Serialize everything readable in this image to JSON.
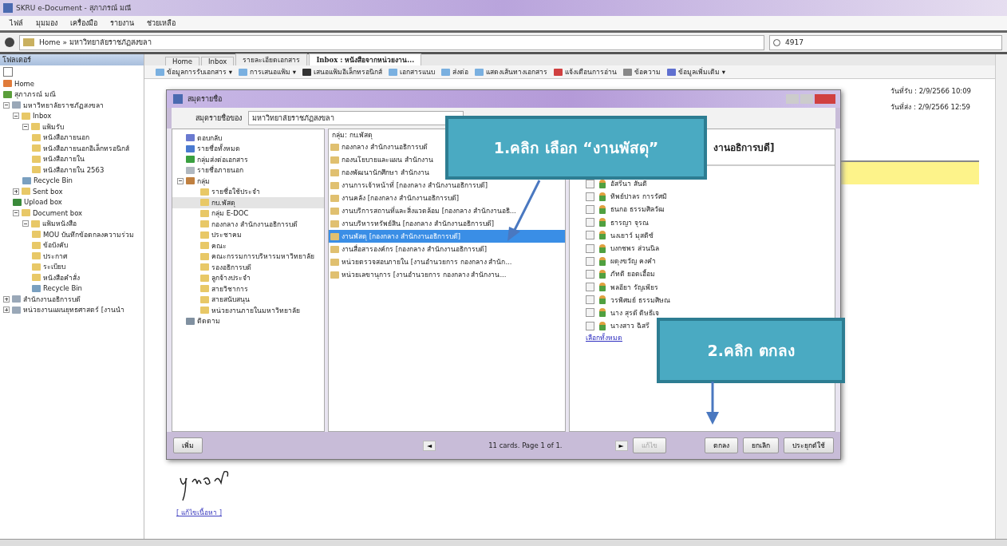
{
  "window": {
    "title": "SKRU e-Document - สุภาภรณ์ มณี"
  },
  "menu": [
    "ไฟล์",
    "มุมมอง",
    "เครื่องมือ",
    "รายงาน",
    "ช่วยเหลือ"
  ],
  "address": {
    "path": "Home » มหาวิทยาลัยราชภัฏสงขลา",
    "search": "4917"
  },
  "sidebar": {
    "title": "โฟลเดอร์",
    "tree": [
      {
        "label": "Home",
        "kind": "home"
      },
      {
        "label": "สุภาภรณ์ มณี",
        "kind": "user"
      },
      {
        "label": "มหาวิทยาลัยราชภัฏสงขลา",
        "kind": "org",
        "expanded": true,
        "children": [
          {
            "label": "Inbox",
            "kind": "folder",
            "expanded": true,
            "children": [
              {
                "label": "แฟ้มรับ",
                "kind": "folder",
                "expanded": true,
                "children": [
                  {
                    "label": "หนังสือภายนอก",
                    "kind": "folder"
                  },
                  {
                    "label": "หนังสือภายนอกอิเล็กทรอนิกส์",
                    "kind": "folder"
                  },
                  {
                    "label": "หนังสือภายใน",
                    "kind": "folder"
                  },
                  {
                    "label": "หนังสือภายใน 2563",
                    "kind": "folder"
                  }
                ]
              },
              {
                "label": "Recycle Bin",
                "kind": "recycle"
              }
            ]
          },
          {
            "label": "Sent box",
            "kind": "folder",
            "expanded": false
          },
          {
            "label": "Upload box",
            "kind": "upload"
          },
          {
            "label": "Document box",
            "kind": "folder",
            "expanded": true,
            "children": [
              {
                "label": "แฟ้มหนังสือ",
                "kind": "folder",
                "expanded": true,
                "children": [
                  {
                    "label": "MOU บันทึกข้อตกลงความร่วม",
                    "kind": "folder"
                  },
                  {
                    "label": "ข้อบังคับ",
                    "kind": "folder"
                  },
                  {
                    "label": "ประกาศ",
                    "kind": "folder"
                  },
                  {
                    "label": "ระเบียบ",
                    "kind": "folder"
                  },
                  {
                    "label": "หนังสือคำสั่ง",
                    "kind": "folder"
                  },
                  {
                    "label": "Recycle Bin",
                    "kind": "recycle"
                  }
                ]
              }
            ]
          }
        ]
      },
      {
        "label": "สำนักงานอธิการบดี",
        "kind": "org",
        "expanded": false
      },
      {
        "label": "หน่วยงานแผนยุทธศาสตร์ [งานนำ",
        "kind": "org",
        "expanded": false
      }
    ]
  },
  "tabs": [
    {
      "label": "Home",
      "selected": false
    },
    {
      "label": "Inbox",
      "selected": false
    },
    {
      "label": "รายละเอียดเอกสาร",
      "selected": false
    },
    {
      "label": "Inbox : หนังสือจากหน่วยงาน...",
      "selected": true
    }
  ],
  "toolbar": [
    {
      "label": "ข้อมูลการรับเอกสาร ▾",
      "kind": "doc"
    },
    {
      "label": "การเสนอแฟ้ม ▾",
      "kind": "doc"
    },
    {
      "label": "เสนอแฟ้มอิเล็กทรอนิกส์",
      "kind": "pen"
    },
    {
      "label": "เอกสารแนบ",
      "kind": "doc"
    },
    {
      "label": "ส่งต่อ",
      "kind": "doc"
    },
    {
      "label": "แสดงเส้นทางเอกสาร",
      "kind": "doc"
    },
    {
      "label": "แจ้งเตือนการอ่าน",
      "kind": "pin"
    },
    {
      "label": "ข้อความ",
      "kind": "note"
    },
    {
      "label": "ข้อมูลเพิ่มเติม ▾",
      "kind": "info"
    }
  ],
  "document": {
    "received": "วันที่รับ : 2/9/2566 10:09",
    "sent": "วันที่ส่ง : 2/9/2566 12:59",
    "edit_link": "[ แก้ไขเนื้อหา ]"
  },
  "dialog": {
    "title": "สมุดรายชื่อ",
    "book_label": "สมุดรายชื่อของ",
    "book_value": "มหาวิทยาลัยราชภัฏสงขลา",
    "groups": [
      {
        "label": "ตอบกลับ",
        "kind": "reply",
        "selected": false
      },
      {
        "label": "รายชื่อทั้งหมด",
        "kind": "book",
        "selected": false
      },
      {
        "label": "กลุ่มส่งต่อเอกสาร",
        "kind": "forward",
        "selected": false
      },
      {
        "label": "รายชื่อภายนอก",
        "kind": "mail",
        "selected": false
      },
      {
        "label": "กลุ่ม",
        "kind": "group",
        "selected": false,
        "expanded": true,
        "children": [
          {
            "label": "รายชื่อใช้ประจำ",
            "kind": "folder",
            "selected": false
          },
          {
            "label": "กบ.พัสดุ",
            "kind": "folder",
            "selected": true
          },
          {
            "label": "กลุ่ม E-DOC",
            "kind": "folder",
            "selected": false
          },
          {
            "label": "กองกลาง สำนักงานอธิการบดี",
            "kind": "folder",
            "selected": false
          },
          {
            "label": "ประชาคม",
            "kind": "folder",
            "selected": false
          },
          {
            "label": "คณะ",
            "kind": "folder",
            "selected": false
          },
          {
            "label": "คณะกรรมการบริหารมหาวิทยาลัย",
            "kind": "folder",
            "selected": false
          },
          {
            "label": "รองอธิการบดี",
            "kind": "folder",
            "selected": false
          },
          {
            "label": "ลูกจ้างประจำ",
            "kind": "folder",
            "selected": false
          },
          {
            "label": "สายวิชาการ",
            "kind": "folder",
            "selected": false
          },
          {
            "label": "สายสนับสนุน",
            "kind": "folder",
            "selected": false
          },
          {
            "label": "หน่วยงานภายในมหาวิทยาลัย",
            "kind": "folder",
            "selected": false
          }
        ]
      },
      {
        "label": "ติดตาม",
        "kind": "phone",
        "selected": false
      }
    ],
    "list_header": "กลุ่ม: กบ.พัสดุ",
    "units": [
      {
        "label": "กองกลาง สำนักงานอธิการบดี",
        "selected": false
      },
      {
        "label": "กองนโยบายและแผน สำนักงาน",
        "selected": false
      },
      {
        "label": "กองพัฒนานักศึกษา สำนักงาน",
        "selected": false
      },
      {
        "label": "งานการเจ้าหน้าที่ [กองกลาง สำนักงานอธิการบดี]",
        "selected": false
      },
      {
        "label": "งานคลัง [กองกลาง สำนักงานอธิการบดี]",
        "selected": false
      },
      {
        "label": "งานบริการสถานที่และสิ่งแวดล้อม [กองกลาง สำนักงานอธิ...",
        "selected": false
      },
      {
        "label": "งานบริหารทรัพย์สิน [กองกลาง สำนักงานอธิการบดี]",
        "selected": false
      },
      {
        "label": "งานพัสดุ [กองกลาง สำนักงานอธิการบดี]",
        "selected": true
      },
      {
        "label": "งานสื่อสารองค์กร [กองกลาง สำนักงานอธิการบดี]",
        "selected": false
      },
      {
        "label": "หน่วยตรวจสอบภายใน [งานอำนวยการ กองกลาง สำนัก...",
        "selected": false
      },
      {
        "label": "หน่วยเลขานุการ [งานอำนวยการ กองกลาง สำนักงาน...",
        "selected": false
      }
    ],
    "members_header": "งานอธิการบดี]",
    "members": [
      {
        "name": "อัสรีนา สันติ",
        "checked": false
      },
      {
        "name": "ทิพย์ปาลร การรัศมิ",
        "checked": false
      },
      {
        "name": "ธนกอ ธรรมศิลวัฒ",
        "checked": false
      },
      {
        "name": "ธารญา จุรณ",
        "checked": false
      },
      {
        "name": "นงเยาว์ มุสดิซ์",
        "checked": false
      },
      {
        "name": "บงกชพร ส่วนนิล",
        "checked": false
      },
      {
        "name": "ผดุงขวัญ คงคำ",
        "checked": false
      },
      {
        "name": "ภัทดิ ยอดเอื้อม",
        "checked": false
      },
      {
        "name": "พลอียา รัญเพียร",
        "checked": false
      },
      {
        "name": "วรพิศมย์ ธรรมศิษณ",
        "checked": false
      },
      {
        "name": "นาง สุรดี ดิษธีเจ",
        "checked": false
      },
      {
        "name": "นางสาว ฉิสรี",
        "checked": false
      }
    ],
    "select_all": "เลือกทั้งหมด",
    "add_button": "เพิ่ม",
    "pager": "11 cards. Page 1 of 1.",
    "prev": "◄",
    "next": "►",
    "edit_button": {
      "label": "แก้ไข",
      "disabled": true
    },
    "buttons": [
      "ตกลง",
      "ยกเลิก",
      "ประยุกต์ใช้"
    ]
  },
  "callouts": [
    "1.คลิก เลือก “งานพัสดุ”",
    "2.คลิก ตกลง"
  ]
}
